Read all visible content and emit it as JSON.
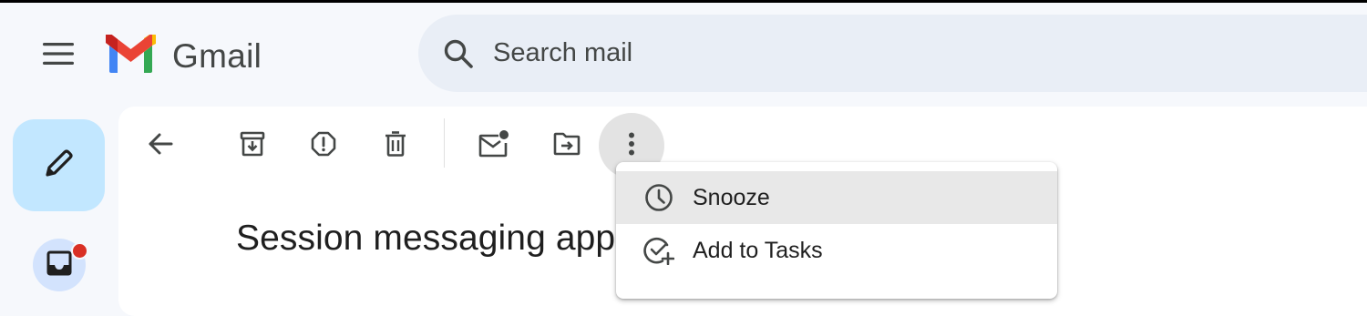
{
  "app": {
    "name": "Gmail"
  },
  "search": {
    "placeholder": "Search mail"
  },
  "toolbar": {
    "back_icon": "arrow-left-icon",
    "archive_icon": "archive-icon",
    "report_spam_icon": "report-spam-icon",
    "delete_icon": "trash-icon",
    "mark_unread_icon": "mark-unread-icon",
    "move_to_icon": "move-to-folder-icon",
    "more_icon": "more-vertical-icon"
  },
  "message": {
    "subject": "Session messaging app"
  },
  "more_menu": {
    "items": [
      {
        "label": "Snooze",
        "icon": "clock-icon"
      },
      {
        "label": "Add to Tasks",
        "icon": "add-task-icon"
      }
    ]
  },
  "colors": {
    "page_background": "#f6f8fc",
    "search_background": "#e9eef6",
    "compose_background": "#c2e7ff",
    "inbox_background": "#d3e3fd",
    "badge": "#d93025",
    "menu_highlight": "#e8e8e8",
    "gmail_red": "#ea4335",
    "gmail_blue": "#4285f4",
    "gmail_green": "#34a853",
    "gmail_yellow": "#fbbc04",
    "gmail_darkred": "#c5221f"
  }
}
